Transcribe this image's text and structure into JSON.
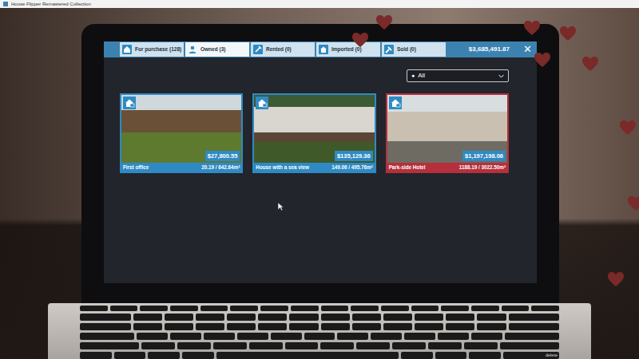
{
  "window": {
    "title": "House Flipper Remastered Collection"
  },
  "tabs": [
    {
      "label": "For purchase (128)",
      "selected": false
    },
    {
      "label": "Owned (3)",
      "selected": true
    },
    {
      "label": "Rented (0)",
      "selected": false
    },
    {
      "label": "Imported (0)",
      "selected": false
    },
    {
      "label": "Sold (0)",
      "selected": false
    }
  ],
  "balance": "$3,685,491.87",
  "close": "✕",
  "filter": {
    "dot": "●",
    "value": "All"
  },
  "properties": [
    {
      "name": "First office",
      "price": "$27,800.55",
      "area": "20.19 / 642.64m²",
      "color": "#2f8ac4"
    },
    {
      "name": "House with a sea view",
      "price": "$135,129.36",
      "area": "149.06 / 495.76m²",
      "color": "#2f8ac4"
    },
    {
      "name": "Park-side Hotel",
      "price": "$1,197,198.06",
      "area": "1188.19 / 3022.50m²",
      "color": "#b5303c"
    }
  ],
  "keyboard": {
    "delete_key": "delete"
  }
}
